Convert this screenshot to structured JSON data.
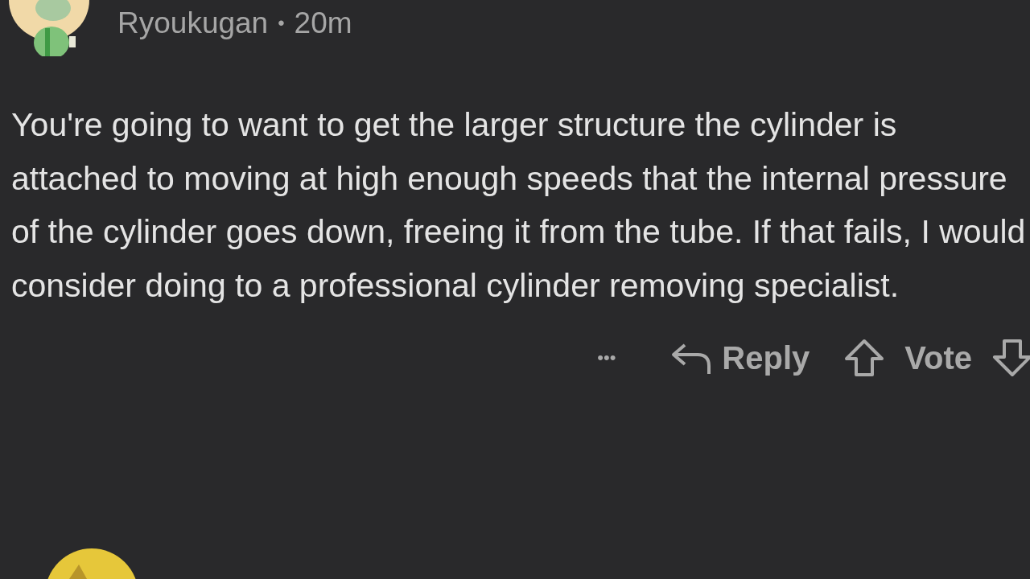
{
  "comment": {
    "author": "Ryoukugan",
    "separator": "•",
    "time": "20m",
    "body": "You're going to want to get the larger structure the cylinder is attached to moving at high enough speeds that the internal pressure of the cylinder goes down, freeing it from the tube. If that fails, I would consider doing to a professional cylinder removing specialist.",
    "actions": {
      "more": "•••",
      "reply": "Reply",
      "vote": "Vote"
    }
  }
}
